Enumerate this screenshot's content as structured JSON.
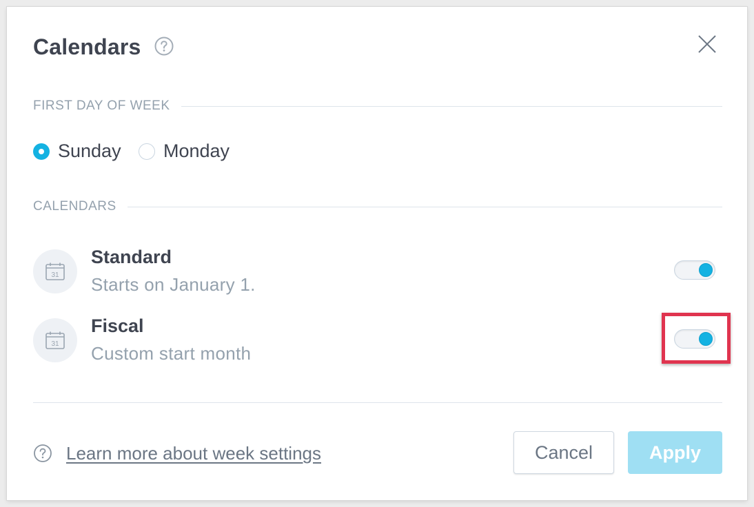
{
  "dialog": {
    "title": "Calendars",
    "close_icon": "close-icon",
    "help_icon": "question-circle-icon"
  },
  "first_day_section": {
    "label": "FIRST DAY OF WEEK",
    "options": [
      {
        "label": "Sunday",
        "selected": true
      },
      {
        "label": "Monday",
        "selected": false
      }
    ]
  },
  "calendars_section": {
    "label": "CALENDARS",
    "items": [
      {
        "title": "Standard",
        "subtitle": "Starts on January 1.",
        "enabled": true,
        "icon": "calendar-icon"
      },
      {
        "title": "Fiscal",
        "subtitle": "Custom start month",
        "enabled": true,
        "icon": "calendar-icon"
      }
    ]
  },
  "footer": {
    "help_link": "Learn more about week settings",
    "cancel_label": "Cancel",
    "apply_label": "Apply"
  },
  "colors": {
    "accent": "#14b2e2",
    "apply_disabled": "#9fdff3",
    "highlight": "#e0344f",
    "title_text": "#3f4450",
    "muted_text": "#94a1ad"
  }
}
